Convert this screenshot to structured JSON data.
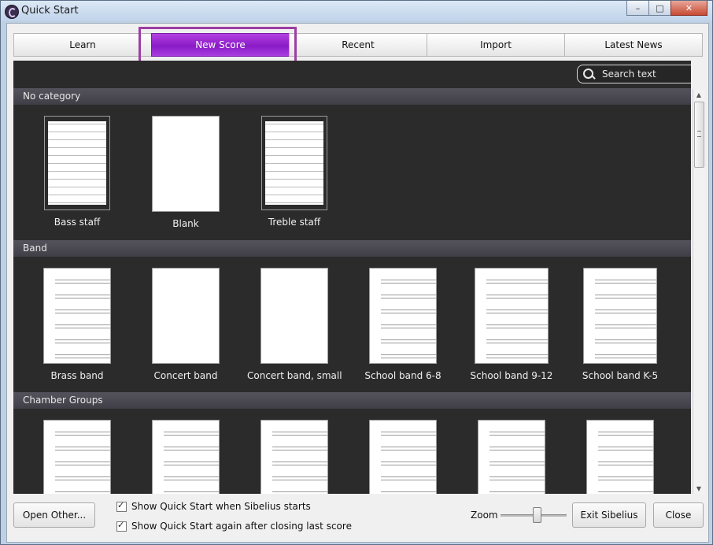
{
  "window": {
    "title": "Quick Start",
    "minimize": "–",
    "maximize": "□",
    "close": "✕"
  },
  "tabs": [
    {
      "label": "Learn"
    },
    {
      "label": "New Score",
      "active": true
    },
    {
      "label": "Recent"
    },
    {
      "label": "Import"
    },
    {
      "label": "Latest News"
    }
  ],
  "search": {
    "placeholder": "Search text"
  },
  "categories": [
    {
      "name": "No category",
      "items": [
        "Bass staff",
        "Blank",
        "Treble staff"
      ]
    },
    {
      "name": "Band",
      "items": [
        "Brass band",
        "Concert band",
        "Concert band, small",
        "School band 6-8",
        "School band 9-12",
        "School band K-5"
      ]
    },
    {
      "name": "Chamber Groups",
      "items": [
        "",
        "",
        "",
        "",
        "",
        ""
      ]
    }
  ],
  "footer": {
    "open_other": "Open Other...",
    "show_on_start": "Show Quick Start when Sibelius starts",
    "show_after_close": "Show Quick Start again after closing last score",
    "zoom_label": "Zoom",
    "zoom_level": 0.55,
    "exit": "Exit Sibelius",
    "close": "Close"
  },
  "colors": {
    "accent": "#9b2fd6",
    "highlight_box": "#9b3fa3",
    "panel_bg": "#2b2b2b"
  }
}
